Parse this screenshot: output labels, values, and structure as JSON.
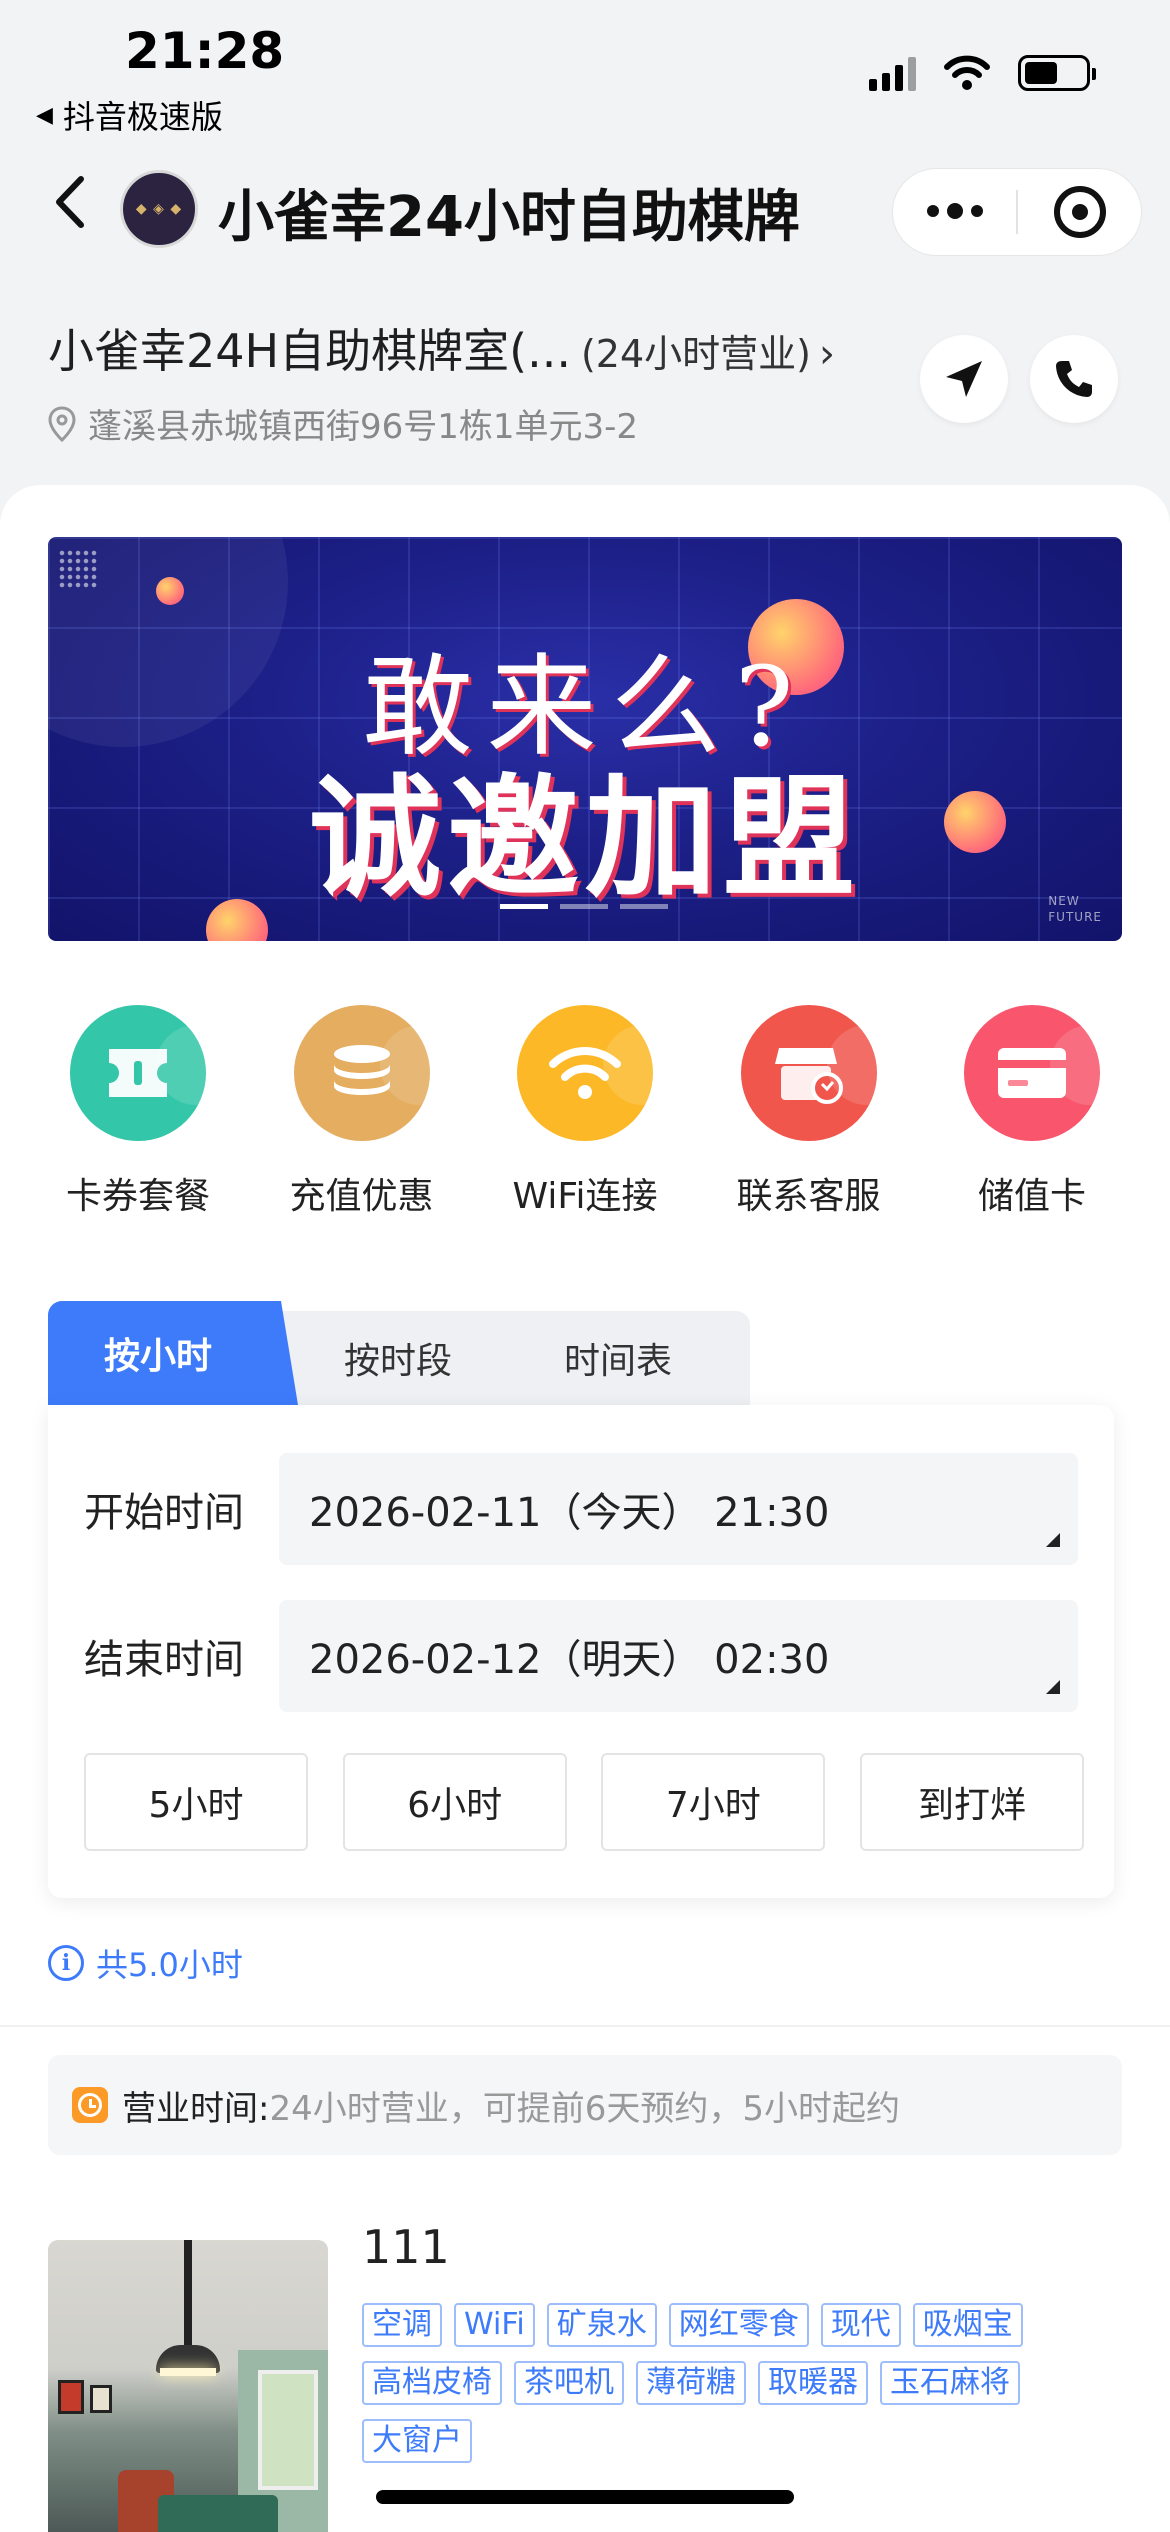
{
  "status_bar": {
    "time": "21:28",
    "back_app": "抖音极速版"
  },
  "nav": {
    "title": "小雀幸24小时自助棋牌"
  },
  "store": {
    "name": "小雀幸24H自助棋牌室(...",
    "hours_tag": "(24小时营业)",
    "address": "蓬溪县赤城镇西街96号1栋1单元3-2"
  },
  "banner": {
    "line1": "敢来么?",
    "line2": "诚邀加盟",
    "corner_text_1": "NEW",
    "corner_text_2": "FUTURE",
    "slide_count": 3,
    "active_slide": 1
  },
  "quick_menu": [
    {
      "label": "卡券套餐",
      "icon": "coupon-icon",
      "color": "#33c6a8"
    },
    {
      "label": "充值优惠",
      "icon": "coins-icon",
      "color": "#e4ad5f"
    },
    {
      "label": "WiFi连接",
      "icon": "wifi-icon",
      "color": "#fcb827"
    },
    {
      "label": "联系客服",
      "icon": "store-service-icon",
      "color": "#f0564c"
    },
    {
      "label": "储值卡",
      "icon": "card-icon",
      "color": "#f9566d"
    }
  ],
  "tabs": {
    "active": "按小时",
    "tab2": "按时段",
    "tab3": "时间表"
  },
  "booking": {
    "start_label": "开始时间",
    "start_value": "2026-02-11（今天） 21:30",
    "end_label": "结束时间",
    "end_value": "2026-02-12（明天） 02:30",
    "presets": [
      "5小时",
      "6小时",
      "7小时",
      "到打烊"
    ],
    "total": "共5.0小时"
  },
  "business_hours": {
    "label": "营业时间:",
    "text": "24小时营业，可提前6天预约，5小时起约"
  },
  "room": {
    "name": "111",
    "amenities": [
      "空调",
      "WiFi",
      "矿泉水",
      "网红零食",
      "现代",
      "吸烟宝",
      "高档皮椅",
      "茶吧机",
      "薄荷糖",
      "取暖器",
      "玉石麻将",
      "大窗户"
    ]
  },
  "colors": {
    "accent": "#3d7bfb",
    "clock": "#fb9a26"
  }
}
